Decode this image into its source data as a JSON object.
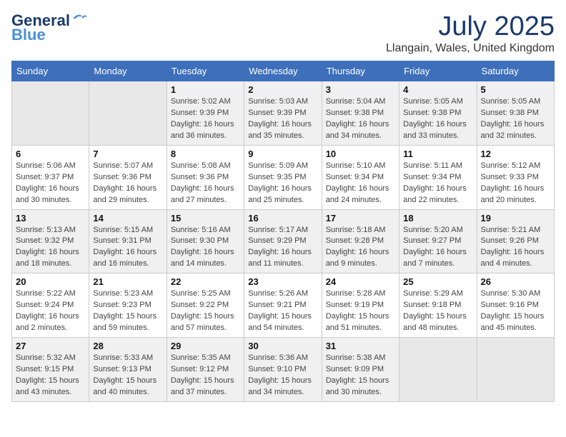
{
  "header": {
    "logo_line1": "General",
    "logo_line2": "Blue",
    "month": "July 2025",
    "location": "Llangain, Wales, United Kingdom"
  },
  "weekdays": [
    "Sunday",
    "Monday",
    "Tuesday",
    "Wednesday",
    "Thursday",
    "Friday",
    "Saturday"
  ],
  "weeks": [
    [
      {
        "day": "",
        "info": ""
      },
      {
        "day": "",
        "info": ""
      },
      {
        "day": "1",
        "info": "Sunrise: 5:02 AM\nSunset: 9:39 PM\nDaylight: 16 hours\nand 36 minutes."
      },
      {
        "day": "2",
        "info": "Sunrise: 5:03 AM\nSunset: 9:39 PM\nDaylight: 16 hours\nand 35 minutes."
      },
      {
        "day": "3",
        "info": "Sunrise: 5:04 AM\nSunset: 9:38 PM\nDaylight: 16 hours\nand 34 minutes."
      },
      {
        "day": "4",
        "info": "Sunrise: 5:05 AM\nSunset: 9:38 PM\nDaylight: 16 hours\nand 33 minutes."
      },
      {
        "day": "5",
        "info": "Sunrise: 5:05 AM\nSunset: 9:38 PM\nDaylight: 16 hours\nand 32 minutes."
      }
    ],
    [
      {
        "day": "6",
        "info": "Sunrise: 5:06 AM\nSunset: 9:37 PM\nDaylight: 16 hours\nand 30 minutes."
      },
      {
        "day": "7",
        "info": "Sunrise: 5:07 AM\nSunset: 9:36 PM\nDaylight: 16 hours\nand 29 minutes."
      },
      {
        "day": "8",
        "info": "Sunrise: 5:08 AM\nSunset: 9:36 PM\nDaylight: 16 hours\nand 27 minutes."
      },
      {
        "day": "9",
        "info": "Sunrise: 5:09 AM\nSunset: 9:35 PM\nDaylight: 16 hours\nand 25 minutes."
      },
      {
        "day": "10",
        "info": "Sunrise: 5:10 AM\nSunset: 9:34 PM\nDaylight: 16 hours\nand 24 minutes."
      },
      {
        "day": "11",
        "info": "Sunrise: 5:11 AM\nSunset: 9:34 PM\nDaylight: 16 hours\nand 22 minutes."
      },
      {
        "day": "12",
        "info": "Sunrise: 5:12 AM\nSunset: 9:33 PM\nDaylight: 16 hours\nand 20 minutes."
      }
    ],
    [
      {
        "day": "13",
        "info": "Sunrise: 5:13 AM\nSunset: 9:32 PM\nDaylight: 16 hours\nand 18 minutes."
      },
      {
        "day": "14",
        "info": "Sunrise: 5:15 AM\nSunset: 9:31 PM\nDaylight: 16 hours\nand 16 minutes."
      },
      {
        "day": "15",
        "info": "Sunrise: 5:16 AM\nSunset: 9:30 PM\nDaylight: 16 hours\nand 14 minutes."
      },
      {
        "day": "16",
        "info": "Sunrise: 5:17 AM\nSunset: 9:29 PM\nDaylight: 16 hours\nand 11 minutes."
      },
      {
        "day": "17",
        "info": "Sunrise: 5:18 AM\nSunset: 9:28 PM\nDaylight: 16 hours\nand 9 minutes."
      },
      {
        "day": "18",
        "info": "Sunrise: 5:20 AM\nSunset: 9:27 PM\nDaylight: 16 hours\nand 7 minutes."
      },
      {
        "day": "19",
        "info": "Sunrise: 5:21 AM\nSunset: 9:26 PM\nDaylight: 16 hours\nand 4 minutes."
      }
    ],
    [
      {
        "day": "20",
        "info": "Sunrise: 5:22 AM\nSunset: 9:24 PM\nDaylight: 16 hours\nand 2 minutes."
      },
      {
        "day": "21",
        "info": "Sunrise: 5:23 AM\nSunset: 9:23 PM\nDaylight: 15 hours\nand 59 minutes."
      },
      {
        "day": "22",
        "info": "Sunrise: 5:25 AM\nSunset: 9:22 PM\nDaylight: 15 hours\nand 57 minutes."
      },
      {
        "day": "23",
        "info": "Sunrise: 5:26 AM\nSunset: 9:21 PM\nDaylight: 15 hours\nand 54 minutes."
      },
      {
        "day": "24",
        "info": "Sunrise: 5:28 AM\nSunset: 9:19 PM\nDaylight: 15 hours\nand 51 minutes."
      },
      {
        "day": "25",
        "info": "Sunrise: 5:29 AM\nSunset: 9:18 PM\nDaylight: 15 hours\nand 48 minutes."
      },
      {
        "day": "26",
        "info": "Sunrise: 5:30 AM\nSunset: 9:16 PM\nDaylight: 15 hours\nand 45 minutes."
      }
    ],
    [
      {
        "day": "27",
        "info": "Sunrise: 5:32 AM\nSunset: 9:15 PM\nDaylight: 15 hours\nand 43 minutes."
      },
      {
        "day": "28",
        "info": "Sunrise: 5:33 AM\nSunset: 9:13 PM\nDaylight: 15 hours\nand 40 minutes."
      },
      {
        "day": "29",
        "info": "Sunrise: 5:35 AM\nSunset: 9:12 PM\nDaylight: 15 hours\nand 37 minutes."
      },
      {
        "day": "30",
        "info": "Sunrise: 5:36 AM\nSunset: 9:10 PM\nDaylight: 15 hours\nand 34 minutes."
      },
      {
        "day": "31",
        "info": "Sunrise: 5:38 AM\nSunset: 9:09 PM\nDaylight: 15 hours\nand 30 minutes."
      },
      {
        "day": "",
        "info": ""
      },
      {
        "day": "",
        "info": ""
      }
    ]
  ]
}
